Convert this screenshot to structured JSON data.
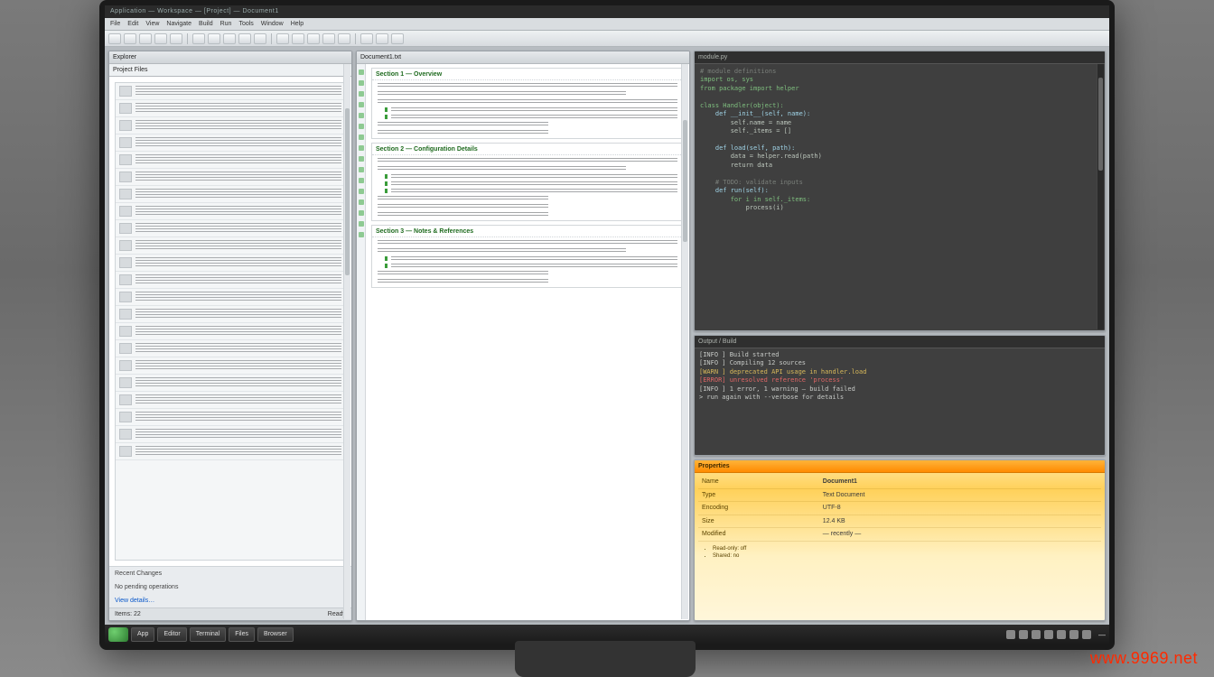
{
  "window": {
    "title": "Application — Workspace — [Project] — Document1",
    "menus": [
      "File",
      "Edit",
      "View",
      "Navigate",
      "Build",
      "Run",
      "Tools",
      "Window",
      "Help"
    ],
    "toolbar_buttons": 18
  },
  "left_panel": {
    "tab": "Explorer",
    "header": "Project Files",
    "rows": 22,
    "status_left": "Items: 22",
    "status_right": "Ready",
    "footer_primary": "Recent Changes",
    "footer_secondary": "No pending operations",
    "footer_link": "View details…"
  },
  "middle_panel": {
    "tab": "Document1.txt",
    "sections": [
      {
        "title": "Section 1 — Overview",
        "paras": 3,
        "bullets": 2,
        "extra": 2
      },
      {
        "title": "Section 2 — Configuration Details",
        "paras": 2,
        "bullets": 3,
        "extra": 3
      },
      {
        "title": "Section 3 — Notes & References",
        "paras": 2,
        "bullets": 2,
        "extra": 2
      }
    ],
    "gutter_marks": 16,
    "scroll_pos": 0.1,
    "scroll_size": 0.22
  },
  "code_panel": {
    "tab": "module.py",
    "lines": [
      {
        "t": "# module definitions",
        "cls": "cm"
      },
      {
        "t": "import os, sys",
        "cls": "kw"
      },
      {
        "t": "from package import helper",
        "cls": "kw"
      },
      {
        "t": "",
        "cls": ""
      },
      {
        "t": "class Handler(object):",
        "cls": "kw"
      },
      {
        "t": "    def __init__(self, name):",
        "cls": "fn"
      },
      {
        "t": "        self.name = name",
        "cls": ""
      },
      {
        "t": "        self._items = []",
        "cls": ""
      },
      {
        "t": "",
        "cls": ""
      },
      {
        "t": "    def load(self, path):",
        "cls": "fn"
      },
      {
        "t": "        data = helper.read(path)",
        "cls": ""
      },
      {
        "t": "        return data",
        "cls": ""
      },
      {
        "t": "",
        "cls": ""
      },
      {
        "t": "    # TODO: validate inputs",
        "cls": "cm"
      },
      {
        "t": "    def run(self):",
        "cls": "fn"
      },
      {
        "t": "        for i in self._items:",
        "cls": "kw"
      },
      {
        "t": "            process(i)",
        "cls": ""
      }
    ],
    "scroll_pos": 0.05,
    "scroll_size": 0.35
  },
  "console_panel": {
    "tab": "Output / Build",
    "lines": [
      {
        "t": "[INFO ] Build started",
        "cls": ""
      },
      {
        "t": "[INFO ] Compiling 12 sources",
        "cls": ""
      },
      {
        "t": "[WARN ] deprecated API usage in handler.load",
        "cls": "wr"
      },
      {
        "t": "[ERROR] unresolved reference 'process'",
        "cls": "err"
      },
      {
        "t": "[INFO ] 1 error, 1 warning — build failed",
        "cls": ""
      },
      {
        "t": "",
        "cls": ""
      },
      {
        "t": "> run again with --verbose for details",
        "cls": "cm"
      }
    ]
  },
  "props_panel": {
    "tab": "Properties",
    "rows": [
      [
        "Name",
        "Document1"
      ],
      [
        "Type",
        "Text Document"
      ],
      [
        "Encoding",
        "UTF-8"
      ],
      [
        "Size",
        "12.4 KB"
      ],
      [
        "Modified",
        "— recently —"
      ]
    ],
    "bullets": [
      "Read-only: off",
      "Shared: no"
    ]
  },
  "taskbar": {
    "tasks": [
      "App",
      "Editor",
      "Terminal",
      "Files",
      "Browser"
    ],
    "tray_icons": 7,
    "clock": "—"
  },
  "watermark": "www.9969.net"
}
